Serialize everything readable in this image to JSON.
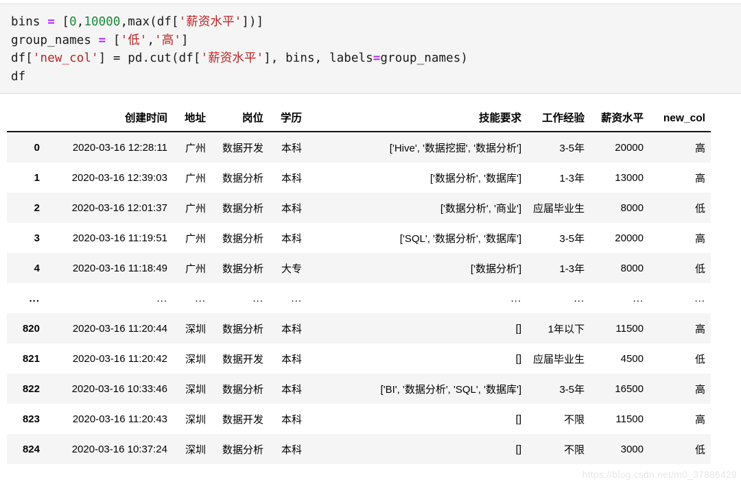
{
  "code_cell": {
    "background": "#f5f5f5",
    "lines": [
      [
        {
          "t": "bins ",
          "c": "plain"
        },
        {
          "t": "=",
          "c": "op"
        },
        {
          "t": " [",
          "c": "plain"
        },
        {
          "t": "0",
          "c": "num"
        },
        {
          "t": ",",
          "c": "plain"
        },
        {
          "t": "10000",
          "c": "num"
        },
        {
          "t": ",max(df[",
          "c": "plain"
        },
        {
          "t": "'薪资水平'",
          "c": "str"
        },
        {
          "t": "])]",
          "c": "plain"
        }
      ],
      [
        {
          "t": "group_names ",
          "c": "plain"
        },
        {
          "t": "=",
          "c": "op"
        },
        {
          "t": " [",
          "c": "plain"
        },
        {
          "t": "'低'",
          "c": "str"
        },
        {
          "t": ",",
          "c": "plain"
        },
        {
          "t": "'高'",
          "c": "str"
        },
        {
          "t": "]",
          "c": "plain"
        }
      ],
      [
        {
          "t": "df[",
          "c": "plain"
        },
        {
          "t": "'new_col'",
          "c": "str"
        },
        {
          "t": "] = pd.cut(df[",
          "c": "plain"
        },
        {
          "t": "'薪资水平'",
          "c": "str"
        },
        {
          "t": "], bins, labels",
          "c": "plain"
        },
        {
          "t": "=",
          "c": "op"
        },
        {
          "t": "group_names)",
          "c": "plain"
        }
      ],
      [
        {
          "t": "df",
          "c": "plain"
        }
      ]
    ],
    "plain_text": "bins = [0,10000,max(df['薪资水平'])]\ngroup_names = ['低','高']\ndf['new_col'] = pd.cut(df['薪资水平'], bins, labels=group_names)\ndf"
  },
  "table": {
    "index_header": "",
    "columns": [
      "创建时间",
      "地址",
      "岗位",
      "学历",
      "技能要求",
      "工作经验",
      "薪资水平",
      "new_col"
    ],
    "rows": [
      {
        "index": "0",
        "cells": [
          "2020-03-16 12:28:11",
          "广州",
          "数据开发",
          "本科",
          "['Hive', '数据挖掘', '数据分析']",
          "3-5年",
          "20000",
          "高"
        ]
      },
      {
        "index": "1",
        "cells": [
          "2020-03-16 12:39:03",
          "广州",
          "数据分析",
          "本科",
          "['数据分析', '数据库']",
          "1-3年",
          "13000",
          "高"
        ]
      },
      {
        "index": "2",
        "cells": [
          "2020-03-16 12:01:37",
          "广州",
          "数据分析",
          "本科",
          "['数据分析', '商业']",
          "应届毕业生",
          "8000",
          "低"
        ]
      },
      {
        "index": "3",
        "cells": [
          "2020-03-16 11:19:51",
          "广州",
          "数据分析",
          "本科",
          "['SQL', '数据分析', '数据库']",
          "3-5年",
          "20000",
          "高"
        ]
      },
      {
        "index": "4",
        "cells": [
          "2020-03-16 11:18:49",
          "广州",
          "数据分析",
          "大专",
          "['数据分析']",
          "1-3年",
          "8000",
          "低"
        ]
      },
      {
        "index": "...",
        "cells": [
          "...",
          "...",
          "...",
          "...",
          "...",
          "...",
          "...",
          "..."
        ]
      },
      {
        "index": "820",
        "cells": [
          "2020-03-16 11:20:44",
          "深圳",
          "数据分析",
          "本科",
          "[]",
          "1年以下",
          "11500",
          "高"
        ]
      },
      {
        "index": "821",
        "cells": [
          "2020-03-16 11:20:42",
          "深圳",
          "数据开发",
          "本科",
          "[]",
          "应届毕业生",
          "4500",
          "低"
        ]
      },
      {
        "index": "822",
        "cells": [
          "2020-03-16 10:33:46",
          "深圳",
          "数据分析",
          "本科",
          "['BI', '数据分析', 'SQL', '数据库']",
          "3-5年",
          "16500",
          "高"
        ]
      },
      {
        "index": "823",
        "cells": [
          "2020-03-16 11:20:43",
          "深圳",
          "数据开发",
          "本科",
          "[]",
          "不限",
          "11500",
          "高"
        ]
      },
      {
        "index": "824",
        "cells": [
          "2020-03-16 10:37:24",
          "深圳",
          "数据分析",
          "本科",
          "[]",
          "不限",
          "3000",
          "低"
        ]
      }
    ]
  },
  "watermark": {
    "text": "https://blog.csdn.net/m0_37886429",
    "color": "#e8e8e8"
  }
}
